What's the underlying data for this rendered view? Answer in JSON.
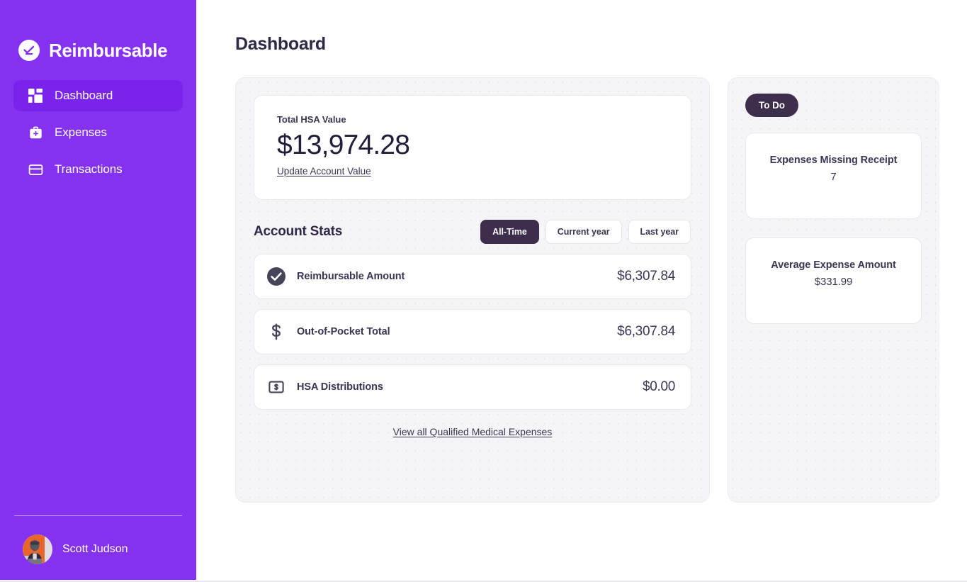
{
  "brand": {
    "name": "Reimbursable",
    "logo_icon": "check-circle-icon"
  },
  "sidebar": {
    "items": [
      {
        "label": "Dashboard",
        "icon": "grid-icon",
        "active": true
      },
      {
        "label": "Expenses",
        "icon": "medical-bag-icon",
        "active": false
      },
      {
        "label": "Transactions",
        "icon": "credit-card-icon",
        "active": false
      }
    ],
    "user": {
      "name": "Scott Judson",
      "avatar_icon": "user-avatar"
    }
  },
  "header": {
    "title": "Dashboard"
  },
  "hsa": {
    "label": "Total HSA Value",
    "value": "$13,974.28",
    "update_link": "Update Account Value"
  },
  "account_stats": {
    "title": "Account Stats",
    "range_options": [
      {
        "label": "All-Time",
        "active": true
      },
      {
        "label": "Current year",
        "active": false
      },
      {
        "label": "Last year",
        "active": false
      }
    ],
    "rows": [
      {
        "label": "Reimbursable Amount",
        "value": "$6,307.84",
        "icon": "check-circle-filled-icon"
      },
      {
        "label": "Out-of-Pocket Total",
        "value": "$6,307.84",
        "icon": "dollar-sign-icon"
      },
      {
        "label": "HSA Distributions",
        "value": "$0.00",
        "icon": "banknote-icon"
      }
    ],
    "view_all_link": "View all Qualified Medical Expenses"
  },
  "todo": {
    "pill_label": "To Do",
    "cards": [
      {
        "title": "Expenses Missing Receipt",
        "value": "7"
      },
      {
        "title": "Average Expense Amount",
        "value": "$331.99"
      }
    ]
  },
  "colors": {
    "sidebar_purple": "#8431f0",
    "sidebar_active": "#7a23ec",
    "accent_dark": "#3e2e4e",
    "text_dark": "#312747",
    "panel_bg": "#f5f5f7",
    "card_bg": "#ffffff"
  }
}
